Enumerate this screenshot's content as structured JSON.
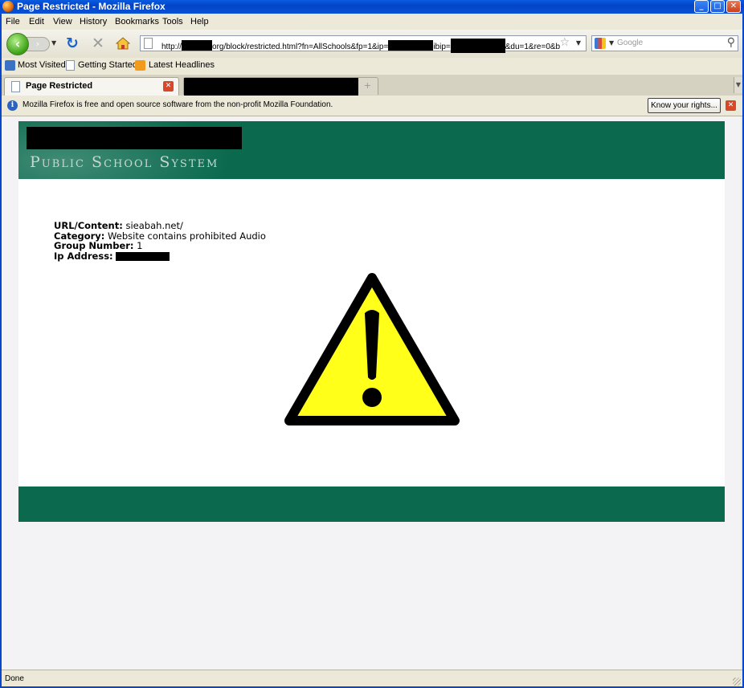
{
  "window": {
    "title": "Page Restricted - Mozilla Firefox"
  },
  "menu": {
    "items": [
      "File",
      "Edit",
      "View",
      "History",
      "Bookmarks",
      "Tools",
      "Help"
    ]
  },
  "nav": {
    "url_segments": [
      "http://",
      "org/block/restricted.html?fn=AllSchools&fp=1&ip=",
      "ibip=",
      "&du=1&re=0&b"
    ],
    "search_placeholder": "Google"
  },
  "bookmarks": {
    "items": [
      "Most Visited",
      "Getting Started",
      "Latest Headlines"
    ]
  },
  "tabs": {
    "active_label": "Page Restricted"
  },
  "notification": {
    "text": "Mozilla Firefox is free and open source software from the non-profit Mozilla Foundation.",
    "button": "Know your rights..."
  },
  "page": {
    "header_subtitle": "Public School System",
    "info": {
      "url_key": "URL/Content:",
      "url_val": " sieabah.net/",
      "cat_key": "Category:",
      "cat_val": " Website contains prohibited Audio",
      "group_key": "Group Number:",
      "group_val": " 1",
      "ip_key": "Ip Address:"
    }
  },
  "status": {
    "text": "Done"
  },
  "colors": {
    "band_green": "#0b6a4e",
    "warning_yellow": "#ffff1a"
  }
}
